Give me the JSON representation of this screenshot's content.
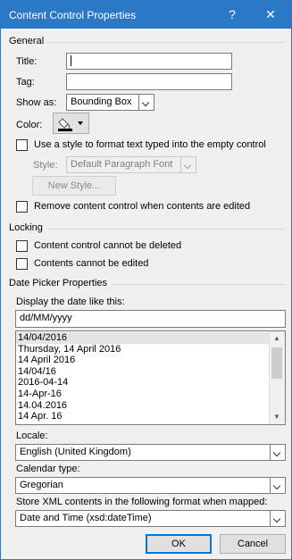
{
  "window": {
    "title": "Content Control Properties",
    "help_glyph": "?",
    "close_glyph": "✕"
  },
  "general": {
    "heading": "General",
    "title_label": "Title:",
    "title_value": "",
    "tag_label": "Tag:",
    "tag_value": "",
    "show_as_label": "Show as:",
    "show_as_value": "Bounding Box",
    "color_label": "Color:",
    "use_style_label": "Use a style to format text typed into the empty control",
    "style_label": "Style:",
    "style_value": "Default Paragraph Font",
    "new_style_label": "New Style...",
    "remove_label": "Remove content control when contents are edited"
  },
  "locking": {
    "heading": "Locking",
    "cannot_delete_label": "Content control cannot be deleted",
    "cannot_edit_label": "Contents cannot be edited"
  },
  "date_picker": {
    "heading": "Date Picker Properties",
    "display_label": "Display the date like this:",
    "format_value": "dd/MM/yyyy",
    "formats": [
      "14/04/2016",
      "Thursday, 14 April 2016",
      "14 April 2016",
      "14/04/16",
      "2016-04-14",
      "14-Apr-16",
      "14.04.2016",
      "14 Apr. 16"
    ],
    "selected_index": 0,
    "locale_label": "Locale:",
    "locale_value": "English (United Kingdom)",
    "calendar_label": "Calendar type:",
    "calendar_value": "Gregorian",
    "store_label": "Store XML contents in the following format when mapped:",
    "store_value": "Date and Time (xsd:dateTime)"
  },
  "buttons": {
    "ok": "OK",
    "cancel": "Cancel"
  },
  "colors": {
    "titlebar": "#2b78c7",
    "dialog_bg": "#f0f0f0",
    "default_button_border": "#0078d7"
  }
}
